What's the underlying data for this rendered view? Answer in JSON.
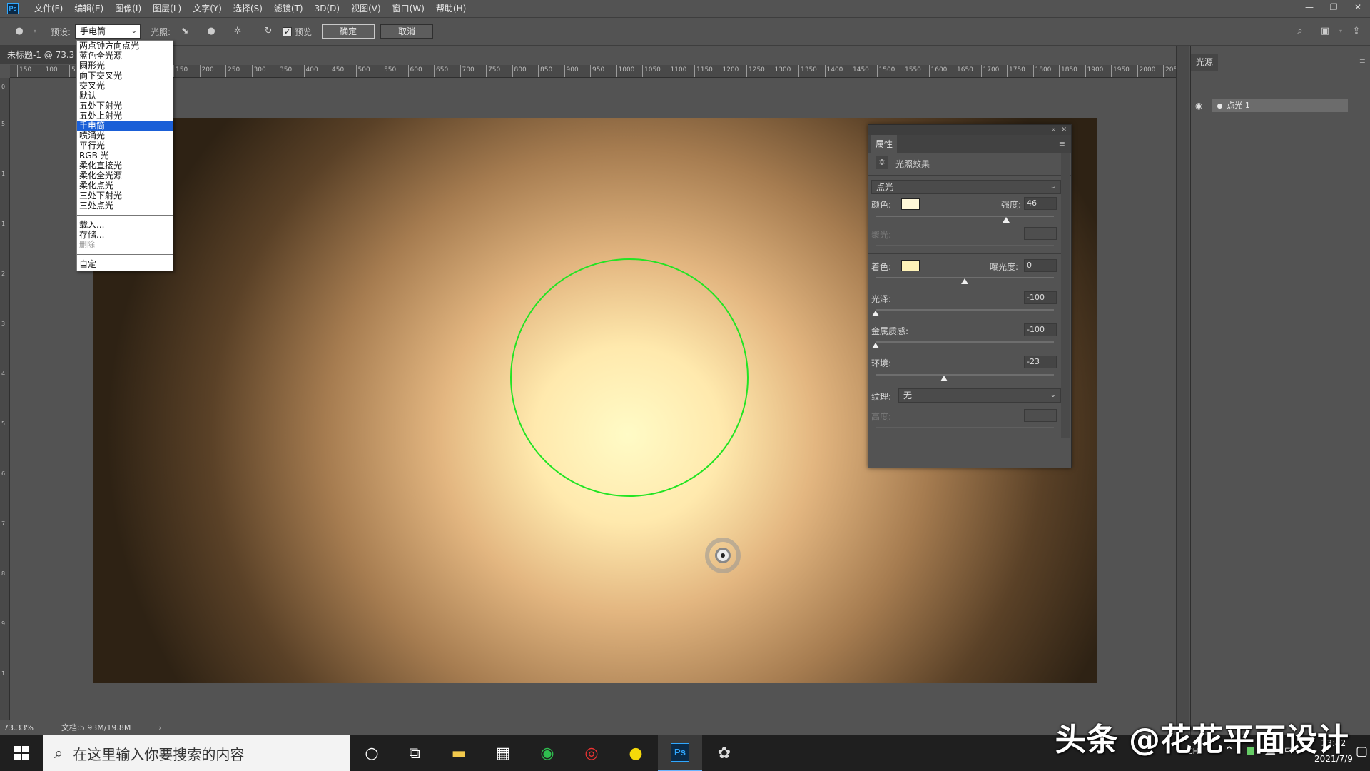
{
  "app": {
    "logo": "Ps"
  },
  "menubar": {
    "items": [
      "文件(F)",
      "编辑(E)",
      "图像(I)",
      "图层(L)",
      "文字(Y)",
      "选择(S)",
      "滤镜(T)",
      "3D(D)",
      "视图(V)",
      "窗口(W)",
      "帮助(H)"
    ]
  },
  "optionsbar": {
    "preset_label": "预设:",
    "preset_value": "手电筒",
    "lights_label": "光照:",
    "preview_label": "预览",
    "ok_label": "确定",
    "cancel_label": "取消"
  },
  "document": {
    "tab_title": "未标题-1 @ 73.3"
  },
  "ruler": {
    "h_labels": [
      "150",
      "100",
      "50",
      "0",
      "50",
      "100",
      "150",
      "200",
      "250",
      "300",
      "350",
      "400",
      "450",
      "500",
      "550",
      "600",
      "650",
      "700",
      "750",
      "800",
      "850",
      "900",
      "950",
      "1000",
      "1050",
      "1100",
      "1150",
      "1200",
      "1250",
      "1300",
      "1350",
      "1400",
      "1450",
      "1500",
      "1550",
      "1600",
      "1650",
      "1700",
      "1750",
      "1800",
      "1850",
      "1900",
      "1950",
      "2000",
      "205"
    ]
  },
  "preset_dropdown": {
    "items": [
      "两点钟方向点光",
      "蓝色全光源",
      "圆形光",
      "向下交叉光",
      "交叉光",
      "默认",
      "五处下射光",
      "五处上射光",
      "手电筒",
      "喷涌光",
      "平行光",
      "RGB 光",
      "柔化直接光",
      "柔化全光源",
      "柔化点光",
      "三处下射光",
      "三处点光"
    ],
    "selected": "手电筒",
    "actions": [
      "载入...",
      "存储...",
      "删除"
    ],
    "custom": "自定"
  },
  "statusbar": {
    "zoom": "73.33%",
    "doc_info": "文档:5.93M/19.8M"
  },
  "lights_panel": {
    "tab": "光源",
    "light_name": "点光 1"
  },
  "properties": {
    "tab": "属性",
    "header": "光照效果",
    "light_type": "点光",
    "color_label": "颜色:",
    "color_value": "#fff8d8",
    "intensity_label": "强度:",
    "intensity": "46",
    "intensity_fraction": 0.73,
    "hotspot_label": "聚光:",
    "colorize_label": "着色:",
    "colorize_value": "#fff3b8",
    "exposure_label": "曝光度:",
    "exposure": "0",
    "exposure_fraction": 0.5,
    "gloss_label": "光泽:",
    "gloss": "-100",
    "gloss_fraction": 0.0,
    "metallic_label": "金属质感:",
    "metallic": "-100",
    "metallic_fraction": 0.0,
    "ambience_label": "环境:",
    "ambience": "-23",
    "ambience_fraction": 0.385,
    "texture_label": "纹理:",
    "texture_value": "无",
    "height_label": "高度:"
  },
  "taskbar": {
    "search_placeholder": "在这里输入你要搜索的内容",
    "time": "23:42",
    "date": "2021/7/9",
    "lang": "CH"
  },
  "watermark": "头条 @花花平面设计"
}
